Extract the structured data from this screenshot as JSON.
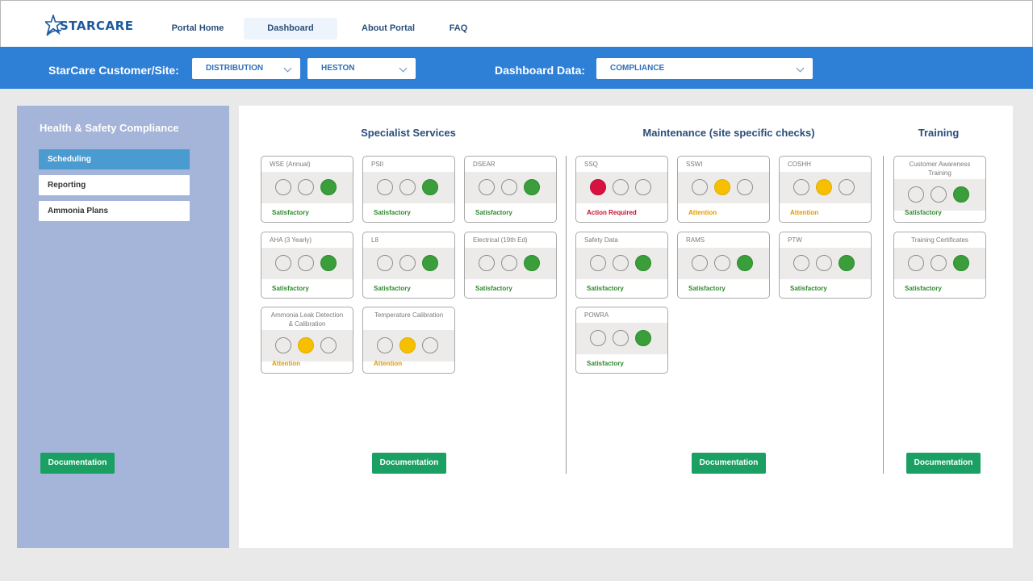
{
  "brand": {
    "name": "STARCARE"
  },
  "nav": {
    "items": [
      {
        "label": "Portal Home"
      },
      {
        "label": "Dashboard"
      },
      {
        "label": "About Portal"
      },
      {
        "label": "FAQ"
      }
    ]
  },
  "filters": {
    "customer_label": "StarCare Customer/Site:",
    "customer_value": "DISTRIBUTION",
    "site_value": "HESTON",
    "dashboard_label": "Dashboard Data:",
    "dashboard_value": "COMPLIANCE"
  },
  "sidebar": {
    "title": "Health & Safety Compliance",
    "items": [
      {
        "label": "Scheduling",
        "active": true
      },
      {
        "label": "Reporting"
      },
      {
        "label": "Ammonia Plans"
      }
    ],
    "doc_label": "Documentation"
  },
  "sections": [
    {
      "title": "Specialist Services",
      "doc_label": "Documentation",
      "cards": [
        {
          "title": "WSE (Annual)",
          "status": "Satisfactory",
          "light": "green"
        },
        {
          "title": "PSII",
          "status": "Satisfactory",
          "light": "green"
        },
        {
          "title": "DSEAR",
          "status": "Satisfactory",
          "light": "green"
        },
        {
          "title": "AHA (3 Yearly)",
          "status": "Satisfactory",
          "light": "green"
        },
        {
          "title": "L8",
          "status": "Satisfactory",
          "light": "green"
        },
        {
          "title": "Electrical (19th Ed)",
          "status": "Satisfactory",
          "light": "green"
        },
        {
          "title": "Ammonia Leak Detection & Calibration",
          "status": "Attention",
          "light": "amber"
        },
        {
          "title": "Temperature Calibration",
          "status": "Attention",
          "light": "amber"
        }
      ]
    },
    {
      "title": "Maintenance (site specific checks)",
      "doc_label": "Documentation",
      "cards": [
        {
          "title": "SSQ",
          "status": "Action Required",
          "light": "red"
        },
        {
          "title": "SSWI",
          "status": "Attention",
          "light": "amber"
        },
        {
          "title": "COSHH",
          "status": "Attention",
          "light": "amber"
        },
        {
          "title": "Safety Data",
          "status": "Satisfactory",
          "light": "green"
        },
        {
          "title": "RAMS",
          "status": "Satisfactory",
          "light": "green"
        },
        {
          "title": "PTW",
          "status": "Satisfactory",
          "light": "green"
        },
        {
          "title": "POWRA",
          "status": "Satisfactory",
          "light": "green"
        }
      ]
    },
    {
      "title": "Training",
      "doc_label": "Documentation",
      "cards": [
        {
          "title": "Customer Awareness Training",
          "status": "Satisfactory",
          "light": "green"
        },
        {
          "title": "Training Certificates",
          "status": "Satisfactory",
          "light": "green"
        }
      ]
    }
  ],
  "colors": {
    "green": "#3a9e3a",
    "amber": "#f6c000",
    "red": "#d8123f",
    "filter_bar": "#2e7fd6",
    "sidebar": "#a5b4d9",
    "doc_button": "#1aa063"
  }
}
